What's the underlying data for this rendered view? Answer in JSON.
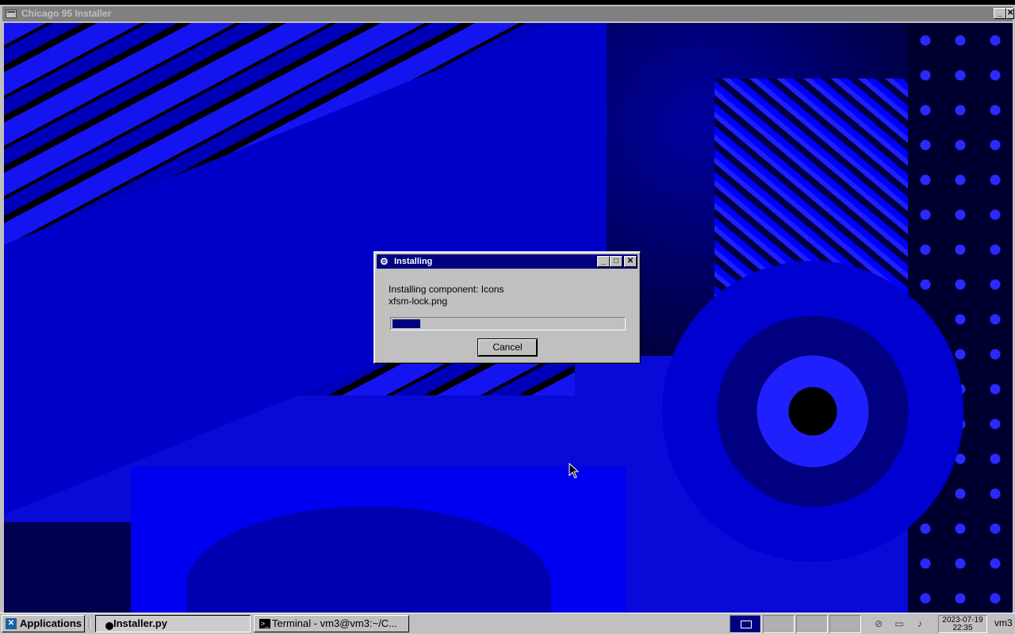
{
  "main_window": {
    "title": "Chicago 95 Installer",
    "minimize": "_",
    "close": "✕"
  },
  "dialog": {
    "title": "Installing",
    "minimize": "_",
    "maximize": "□",
    "close": "✕",
    "component_line": "Installing component: Icons",
    "file_line": "xfsm-lock.png",
    "progress_fraction": 0.12,
    "cancel_label": "Cancel"
  },
  "taskbar": {
    "applications_label": "Applications",
    "tasks": [
      {
        "label": "Installer.py",
        "active": true
      },
      {
        "label": "Terminal - vm3@vm3:~/C...",
        "active": false
      }
    ],
    "workspaces": 4,
    "clock_date": "2023-07-19",
    "clock_time": "22:35",
    "user": "vm3"
  },
  "colors": {
    "titlebar_active": "#000080",
    "titlebar_inactive": "#808080",
    "face": "#c0c0c0",
    "wallpaper": "#0a0ad8"
  },
  "icons": [
    "app-window-icon",
    "installer-icon",
    "applications-icon",
    "terminal-icon",
    "mute-icon",
    "battery-icon",
    "notification-icon",
    "mouse-cursor-icon"
  ]
}
